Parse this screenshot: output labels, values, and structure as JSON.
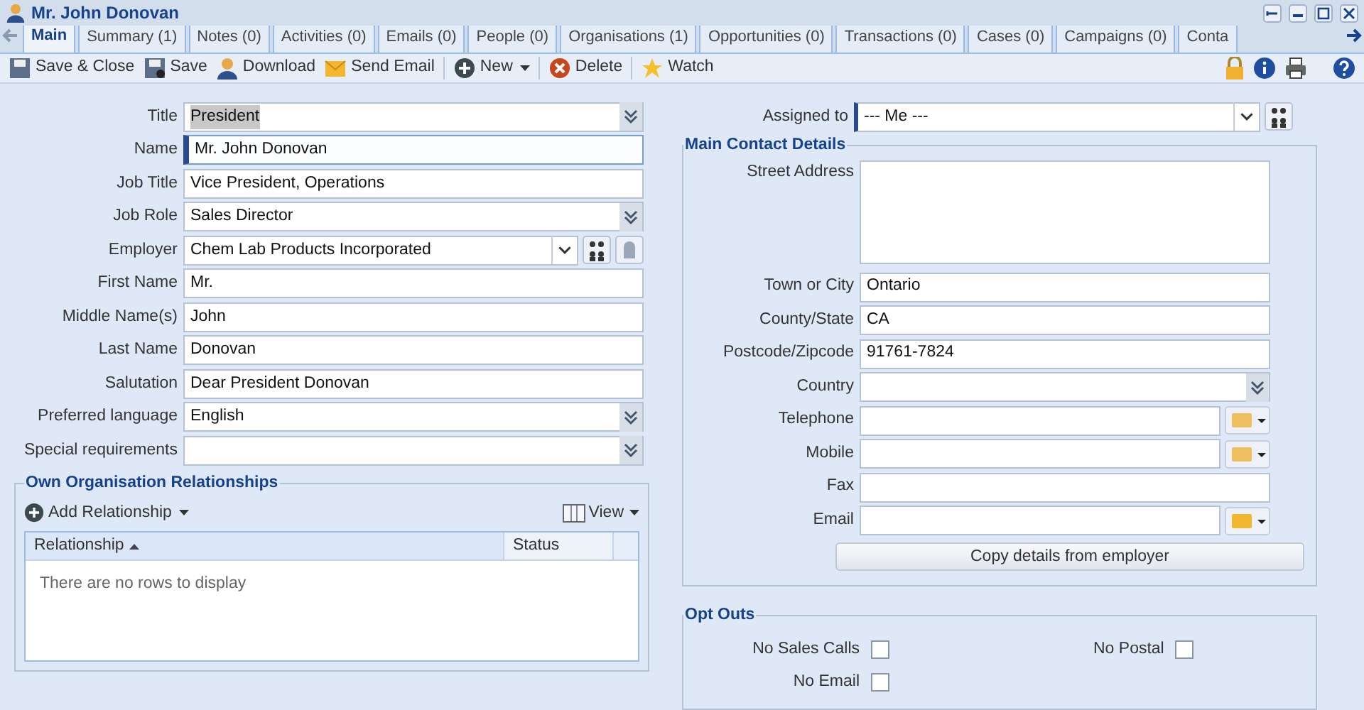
{
  "window": {
    "title": "Mr. John Donovan"
  },
  "tabs": [
    {
      "label": "Main",
      "selected": true
    },
    {
      "label": "Summary (1)",
      "selected": false
    },
    {
      "label": "Notes (0)",
      "selected": false
    },
    {
      "label": "Activities (0)",
      "selected": false
    },
    {
      "label": "Emails (0)",
      "selected": false
    },
    {
      "label": "People (0)",
      "selected": false
    },
    {
      "label": "Organisations (1)",
      "selected": false
    },
    {
      "label": "Opportunities (0)",
      "selected": false
    },
    {
      "label": "Transactions (0)",
      "selected": false
    },
    {
      "label": "Cases (0)",
      "selected": false
    },
    {
      "label": "Campaigns (0)",
      "selected": false
    },
    {
      "label": "Conta",
      "selected": false
    }
  ],
  "toolbar": [
    {
      "label": "Save & Close",
      "dropdown": false
    },
    {
      "label": "Save",
      "dropdown": false
    },
    {
      "label": "Download",
      "dropdown": false
    },
    {
      "label": "Send Email",
      "dropdown": false
    },
    {
      "label": "New",
      "dropdown": true
    },
    {
      "label": "Delete",
      "dropdown": false
    },
    {
      "label": "Watch",
      "dropdown": false
    }
  ],
  "left_fields": [
    {
      "label": "Title",
      "value": "President",
      "kind": "combo",
      "focused": false,
      "highlighted": true
    },
    {
      "label": "Name",
      "value": "Mr. John Donovan",
      "kind": "text",
      "focused": true,
      "highlighted": false
    },
    {
      "label": "Job Title",
      "value": "Vice President, Operations",
      "kind": "text",
      "focused": false,
      "highlighted": false
    },
    {
      "label": "Job Role",
      "value": "Sales Director",
      "kind": "combo",
      "focused": false,
      "highlighted": false
    },
    {
      "label": "Employer",
      "value": "Chem Lab Products Incorporated",
      "kind": "employer",
      "focused": false,
      "highlighted": false
    },
    {
      "label": "First Name",
      "value": "Mr.",
      "kind": "text",
      "focused": false,
      "highlighted": false
    },
    {
      "label": "Middle Name(s)",
      "value": "John",
      "kind": "text",
      "focused": false,
      "highlighted": false
    },
    {
      "label": "Last Name",
      "value": "Donovan",
      "kind": "text",
      "focused": false,
      "highlighted": false
    },
    {
      "label": "Salutation",
      "value": "Dear President Donovan",
      "kind": "text",
      "focused": false,
      "highlighted": false
    },
    {
      "label": "Preferred language",
      "value": "English",
      "kind": "combo",
      "focused": false,
      "highlighted": false
    },
    {
      "label": "Special requirements",
      "kind": "combo",
      "focused": false,
      "highlighted": false
    }
  ],
  "relationships": {
    "title": "Own Organisation Relationships",
    "add_button": "Add Relationship",
    "view_button": "View",
    "columns": [
      {
        "label": "Relationship",
        "sorted": true
      },
      {
        "label": "Status",
        "sorted": false
      }
    ],
    "empty_text": "There are no rows to display"
  },
  "assigned": {
    "label": "Assigned to",
    "value": "--- Me ---",
    "focused": true
  },
  "contact": {
    "title": "Main Contact Details",
    "fields": [
      {
        "label": "Street Address",
        "kind": "textarea"
      },
      {
        "label": "Town or City",
        "value": "Ontario",
        "kind": "text"
      },
      {
        "label": "County/State",
        "value": "CA",
        "kind": "text"
      },
      {
        "label": "Postcode/Zipcode",
        "value": "91761-7824",
        "kind": "text"
      },
      {
        "label": "Country",
        "kind": "combo"
      },
      {
        "label": "Telephone",
        "kind": "phone"
      },
      {
        "label": "Mobile",
        "kind": "phone"
      },
      {
        "label": "Fax",
        "kind": "text"
      },
      {
        "label": "Email",
        "kind": "email"
      }
    ],
    "copy_button": "Copy details from employer"
  },
  "opt_outs": {
    "title": "Opt Outs",
    "items": [
      {
        "label": "No Sales Calls",
        "checked": false
      },
      {
        "label": "No Postal",
        "checked": false
      },
      {
        "label": "No Email",
        "checked": false
      }
    ]
  }
}
